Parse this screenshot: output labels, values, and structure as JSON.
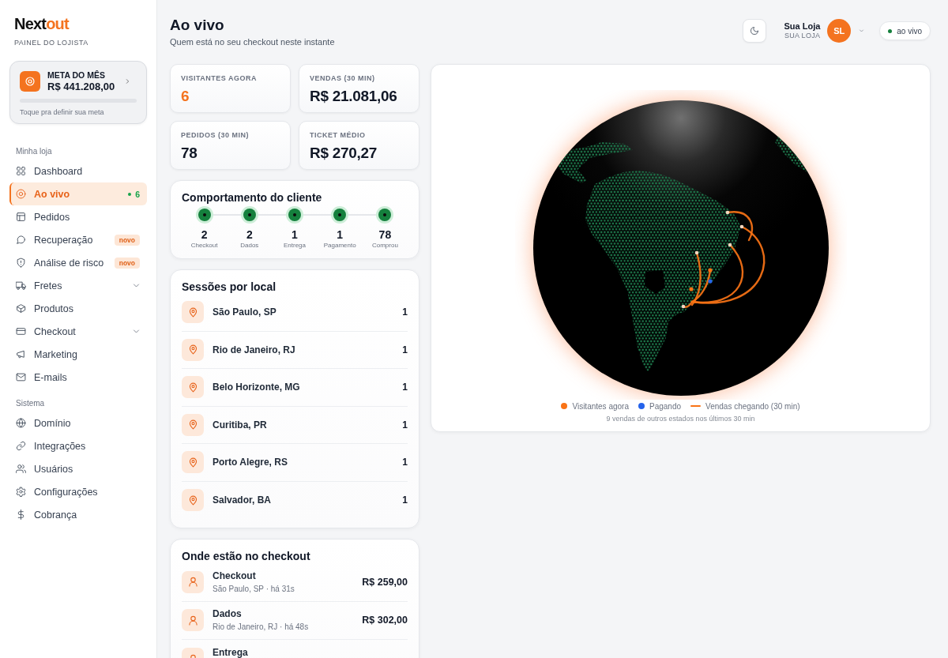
{
  "sidebar": {
    "logo": {
      "text": "Next",
      "accent": "out"
    },
    "subtitle": "PAINEL DO LOJISTA",
    "goal": {
      "title": "META DO MÊS",
      "value": "R$ 441.208,00",
      "level": 0,
      "hint": "Toque pra definir sua meta"
    },
    "sections": [
      {
        "title": "Minha loja",
        "items": [
          {
            "label": "Dashboard",
            "kind": "link",
            "selected": false
          },
          {
            "label": "Ao vivo",
            "kind": "link",
            "selected": true,
            "count": "6"
          },
          {
            "label": "Pedidos",
            "kind": "link",
            "selected": false
          },
          {
            "label": "Recuperação",
            "kind": "link",
            "selected": false,
            "badge": "novo"
          },
          {
            "label": "Análise de risco",
            "kind": "link",
            "selected": false,
            "badge": "novo"
          },
          {
            "label": "Fretes",
            "kind": "group",
            "selected": false,
            "expanded": false
          },
          {
            "label": "Produtos",
            "kind": "link",
            "selected": false
          },
          {
            "label": "Checkout",
            "kind": "group",
            "selected": false,
            "expanded": false
          },
          {
            "label": "Marketing",
            "kind": "link",
            "selected": false
          },
          {
            "label": "E-mails",
            "kind": "link",
            "selected": false
          }
        ]
      },
      {
        "title": "Sistema",
        "items": [
          {
            "label": "Domínio",
            "kind": "link",
            "selected": false
          },
          {
            "label": "Integrações",
            "kind": "link",
            "selected": false
          },
          {
            "label": "Usuários",
            "kind": "link",
            "selected": false
          },
          {
            "label": "Configurações",
            "kind": "link",
            "selected": false
          },
          {
            "label": "Cobrança",
            "kind": "link",
            "selected": false
          }
        ]
      }
    ]
  },
  "header": {
    "title": "Ao vivo",
    "subtitle": "Quem está no seu checkout neste instante",
    "user": {
      "name": "Sua Loja",
      "role": "SUA LOJA",
      "initials": "SL"
    },
    "status": "ao vivo"
  },
  "stats": [
    {
      "label": "VISITANTES AGORA",
      "value": "6",
      "highlight": true
    },
    {
      "label": "VENDAS (30 MIN)",
      "value": "R$ 21.081,06",
      "highlight": false
    },
    {
      "label": "PEDIDOS (30 MIN)",
      "value": "78",
      "highlight": false
    },
    {
      "label": "TICKET MÉDIO",
      "value": "R$ 270,27",
      "highlight": false
    }
  ],
  "behavior": {
    "title": "Comportamento do cliente",
    "steps": [
      {
        "count": "2",
        "label": "Checkout"
      },
      {
        "count": "2",
        "label": "Dados"
      },
      {
        "count": "1",
        "label": "Entrega"
      },
      {
        "count": "1",
        "label": "Pagamento"
      },
      {
        "count": "78",
        "label": "Comprou"
      }
    ]
  },
  "sessions": {
    "title": "Sessões por local",
    "rows": [
      {
        "place": "São Paulo, SP",
        "count": "1"
      },
      {
        "place": "Rio de Janeiro, RJ",
        "count": "1"
      },
      {
        "place": "Belo Horizonte, MG",
        "count": "1"
      },
      {
        "place": "Curitiba, PR",
        "count": "1"
      },
      {
        "place": "Porto Alegre, RS",
        "count": "1"
      },
      {
        "place": "Salvador, BA",
        "count": "1"
      }
    ]
  },
  "checkout": {
    "title": "Onde estão no checkout",
    "rows": [
      {
        "stage": "Checkout",
        "detail": "São Paulo, SP · há 31s",
        "price": "R$ 259,00"
      },
      {
        "stage": "Dados",
        "detail": "Rio de Janeiro, RJ · há 48s",
        "price": "R$ 302,00"
      },
      {
        "stage": "Entrega"
      }
    ]
  },
  "map": {
    "legend": [
      {
        "label": "Visitantes agora",
        "kind": "dot",
        "color": "#f97316"
      },
      {
        "label": "Pagando",
        "kind": "dot",
        "color": "#2563eb"
      },
      {
        "label": "Vendas chegando (30 min)",
        "kind": "line",
        "color": "#f97316"
      }
    ],
    "note": "9 vendas de outros estados nos últimos 30 min"
  }
}
